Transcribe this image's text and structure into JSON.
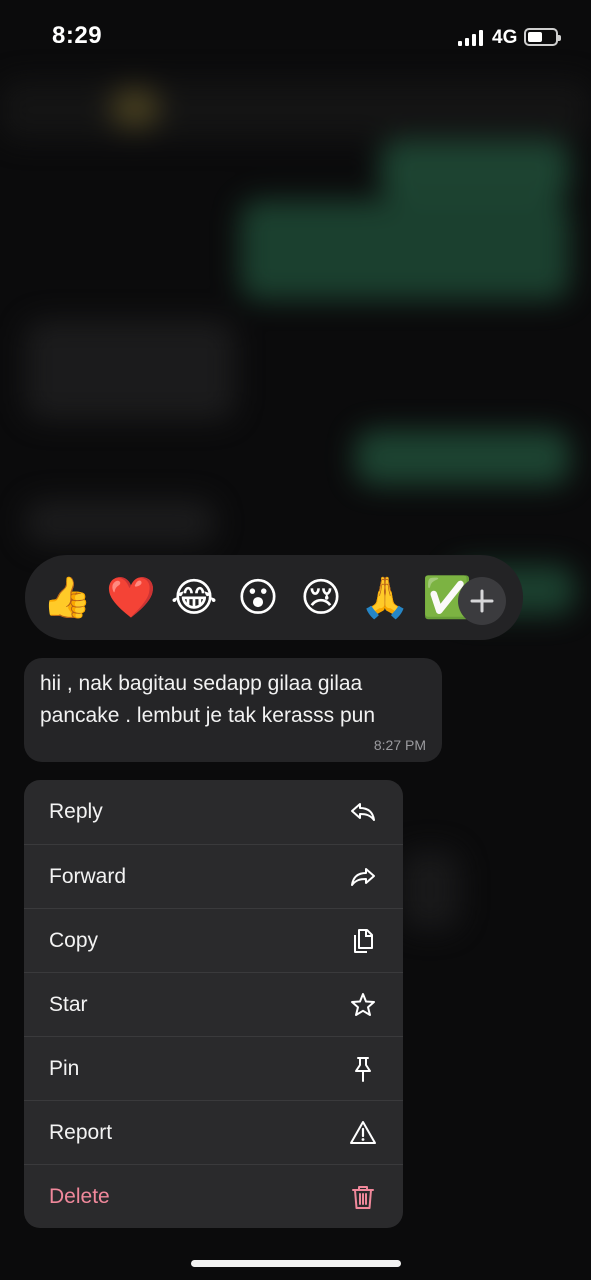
{
  "status_bar": {
    "time": "8:29",
    "network": "4G"
  },
  "reactions": [
    {
      "emoji": "👍",
      "name": "thumbs-up"
    },
    {
      "emoji": "❤️",
      "name": "heart"
    },
    {
      "emoji": "😂",
      "name": "tears-of-joy"
    },
    {
      "emoji": "😮",
      "name": "surprised"
    },
    {
      "emoji": "😢",
      "name": "crying"
    },
    {
      "emoji": "🙏",
      "name": "folded-hands"
    },
    {
      "emoji": "✅",
      "name": "check-mark"
    }
  ],
  "message": {
    "text": "hii , nak bagitau sedapp gilaa gilaa pancake . lembut je tak kerasss pun",
    "time": "8:27 PM"
  },
  "menu": {
    "items": [
      {
        "label": "Reply",
        "icon": "reply-icon"
      },
      {
        "label": "Forward",
        "icon": "forward-icon"
      },
      {
        "label": "Copy",
        "icon": "copy-icon"
      },
      {
        "label": "Star",
        "icon": "star-icon"
      },
      {
        "label": "Pin",
        "icon": "pin-icon"
      },
      {
        "label": "Report",
        "icon": "warning-icon"
      },
      {
        "label": "Delete",
        "icon": "trash-icon"
      }
    ]
  },
  "colors": {
    "background": "#0b0b0c",
    "menu": "#2a2a2c",
    "delete": "#f0889b",
    "blurred_outgoing": "#1f4a36"
  }
}
